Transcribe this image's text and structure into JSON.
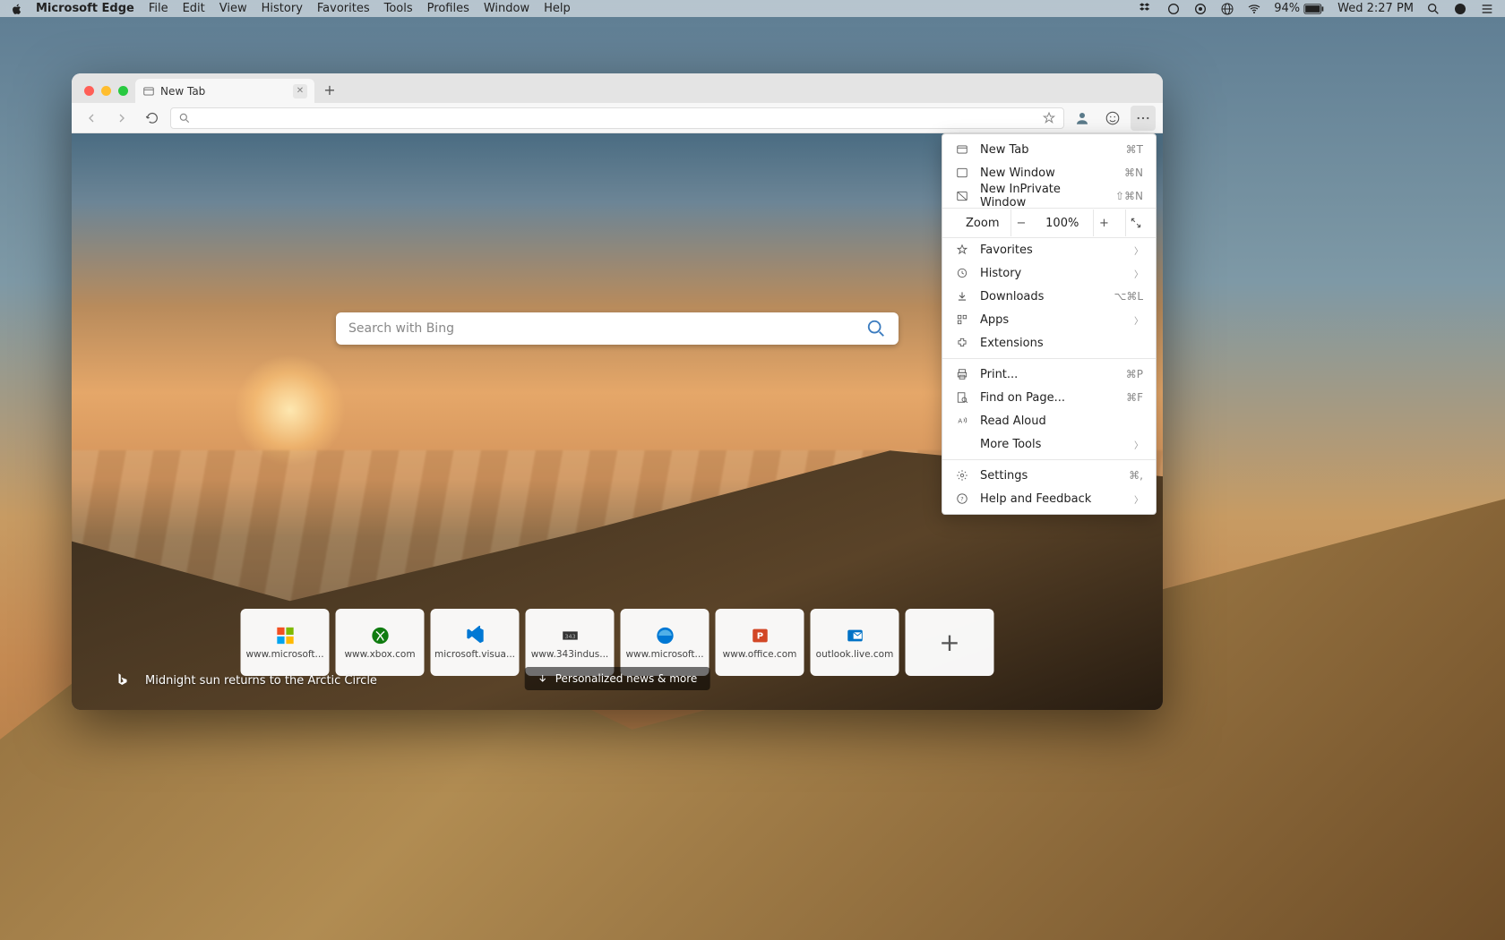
{
  "os_menubar": {
    "app_name": "Microsoft Edge",
    "items": [
      "File",
      "Edit",
      "View",
      "History",
      "Favorites",
      "Tools",
      "Profiles",
      "Window",
      "Help"
    ],
    "battery": "94%",
    "clock": "Wed 2:27 PM"
  },
  "tabstrip": {
    "tab_title": "New Tab",
    "new_tab_plus": "+"
  },
  "toolbar": {
    "more_active": true
  },
  "newtab": {
    "search_placeholder": "Search with Bing",
    "headline": "Midnight sun returns to the Arctic Circle",
    "news_pill": "Personalized news & more",
    "tiles": [
      {
        "label": "www.microsoft...",
        "icon": "ms-logo"
      },
      {
        "label": "www.xbox.com",
        "icon": "xbox"
      },
      {
        "label": "microsoft.visua...",
        "icon": "vscode"
      },
      {
        "label": "www.343indus...",
        "icon": "343"
      },
      {
        "label": "www.microsoft...",
        "icon": "edge"
      },
      {
        "label": "www.office.com",
        "icon": "ppt"
      },
      {
        "label": "outlook.live.com",
        "icon": "outlook"
      }
    ]
  },
  "dropdown": {
    "new_tab": "New Tab",
    "new_tab_k": "⌘T",
    "new_win": "New Window",
    "new_win_k": "⌘N",
    "new_inpriv": "New InPrivate Window",
    "new_inpriv_k": "⇧⌘N",
    "zoom_label": "Zoom",
    "zoom_val": "100%",
    "favorites": "Favorites",
    "history": "History",
    "downloads": "Downloads",
    "downloads_k": "⌥⌘L",
    "apps": "Apps",
    "extensions": "Extensions",
    "print": "Print...",
    "print_k": "⌘P",
    "find": "Find on Page...",
    "find_k": "⌘F",
    "read_aloud": "Read Aloud",
    "more_tools": "More Tools",
    "settings": "Settings",
    "settings_k": "⌘,",
    "help": "Help and Feedback"
  }
}
